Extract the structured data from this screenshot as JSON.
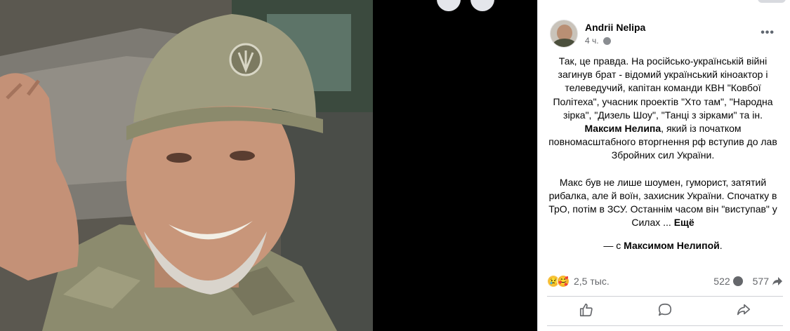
{
  "post": {
    "author": "Andrii Nelipa",
    "time": "4 ч.",
    "more_icon": "more-dots-icon",
    "text_p1_a": "Так, це правда. На російсько-українській війні загинув брат - відомий український кіноактор і телеведучий, капітан команди КВН \"Ковбої Політеха\", учасник проектів \"Хто там\", \"Народна зірка\", \"Дизель Шоу\", \"Танці з зірками\" та ін. ",
    "text_p1_name": "Максим Нелипа",
    "text_p1_b": ", який із початком повномасштабного вторгнення рф вступив до лав Збройних сил України.",
    "text_p2": "Макс був не лише шоумен, гуморист, затятий рибалка, але й воїн, захисник України. Спочатку в ТрО, потім в ЗСУ. Останнім часом він \"виступав\" у Силах ... ",
    "see_more": "Ещё",
    "with_prefix": "— с ",
    "with_name": "Максимом Нелипой",
    "with_suffix": "."
  },
  "stats": {
    "reactions": "2,5 тыс.",
    "comments": "522",
    "shares": "577"
  },
  "actions": {
    "like_icon": "thumbs-up-icon",
    "comment_icon": "comment-icon",
    "share_icon": "share-icon"
  },
  "colors": {
    "text": "#050505",
    "secondary": "#65676b",
    "divider": "#ced0d4"
  }
}
